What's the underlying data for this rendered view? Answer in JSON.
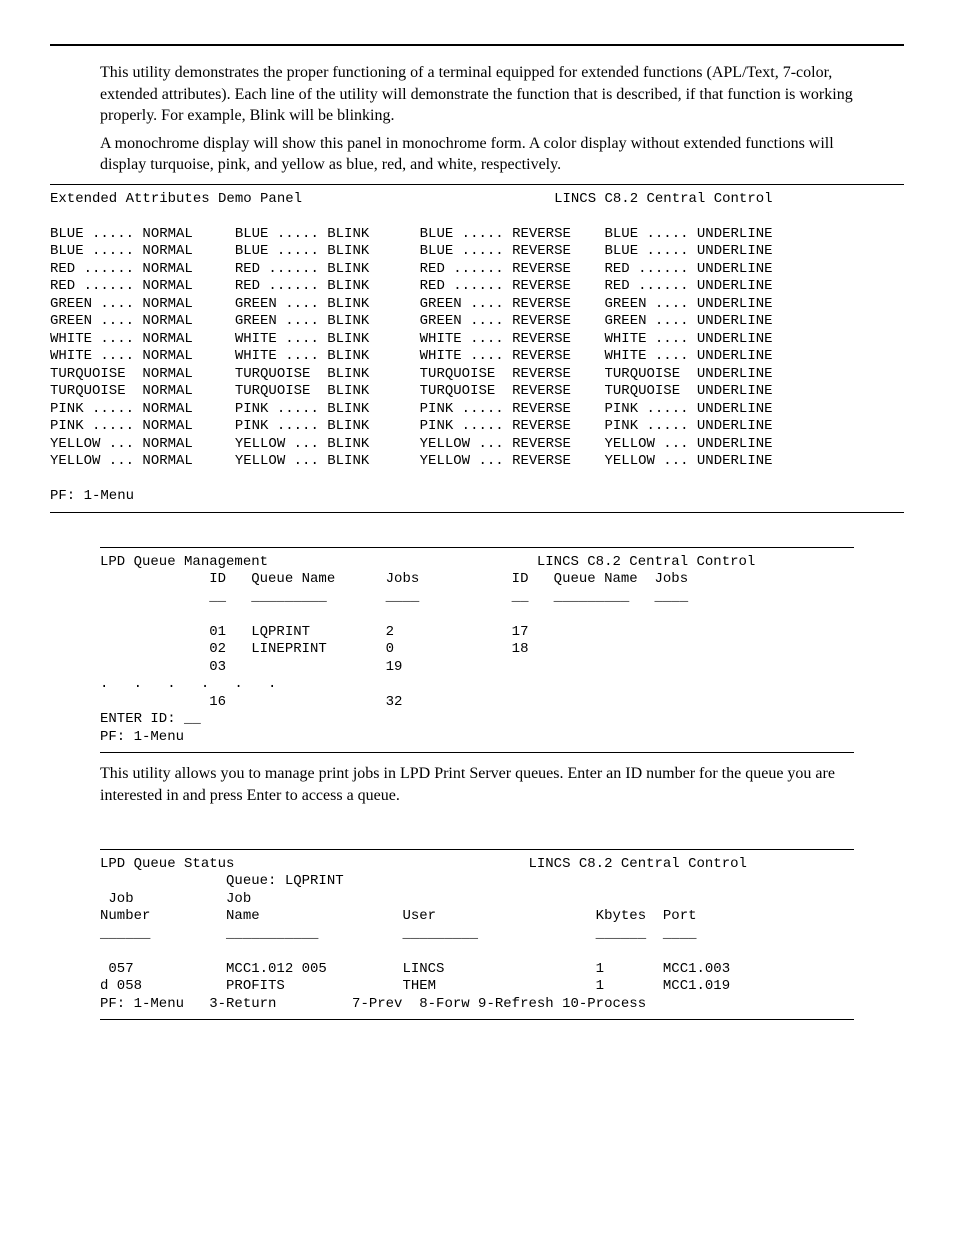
{
  "top": {
    "paragraphs": [
      "This utility demonstrates the proper functioning of a terminal equipped for extended functions (APL/Text, 7-color, extended attributes). Each line of the utility will demonstrate the function that is described, if that function is working properly. For example, Blink will be blinking.",
      "A monochrome display will show this panel in monochrome form. A color display without extended functions will display turquoise, pink, and yellow as blue, red, and white, respectively."
    ]
  },
  "panel1": {
    "title_left": "Extended Attributes Demo Panel",
    "title_right": "LINCS C8.2 Central Control",
    "colors": [
      "BLUE",
      "BLUE",
      "RED",
      "RED",
      "GREEN",
      "GREEN",
      "WHITE",
      "WHITE",
      "TURQUOISE",
      "TURQUOISE",
      "PINK",
      "PINK",
      "YELLOW",
      "YELLOW"
    ],
    "attrs": [
      "NORMAL",
      "BLINK",
      "REVERSE",
      "UNDERLINE"
    ],
    "footer": "PF: 1-Menu"
  },
  "panel2": {
    "title_left": "LPD Queue Management",
    "title_right": "LINCS C8.2 Central Control",
    "headers": {
      "id": "ID",
      "qn": "Queue Name",
      "jobs": "Jobs"
    },
    "rows_left": [
      {
        "id": "01",
        "name": "LQPRINT",
        "jobs": "2"
      },
      {
        "id": "02",
        "name": "LINEPRINT",
        "jobs": "0"
      },
      {
        "id": "03",
        "name": "",
        "jobs": "19"
      }
    ],
    "rows_right": [
      {
        "id": "17",
        "name": "",
        "jobs": ""
      },
      {
        "id": "18",
        "name": "",
        "jobs": ""
      }
    ],
    "continuation": ".   .   .   .   .   .",
    "last_left": {
      "id": "16",
      "name": "",
      "jobs": "32"
    },
    "enter_prompt": "ENTER ID: __",
    "footer": "PF: 1-Menu",
    "description": "This utility allows you to manage print jobs in LPD Print Server queues. Enter an ID number for the queue you are interested in and press Enter to access a queue."
  },
  "panel3": {
    "title_left": "LPD Queue Status",
    "title_right": "LINCS C8.2 Central Control",
    "queue_line": "Queue: LQPRINT",
    "headers": {
      "job_number1": "Job",
      "job_number2": "Number",
      "job_name1": "Job",
      "job_name2": "Name",
      "user": "User",
      "kbytes": "Kbytes",
      "port": "Port"
    },
    "rows": [
      {
        "num": " 057",
        "name": "MCC1.012 005",
        "user": "LINCS",
        "kb": "1",
        "port": "MCC1.003"
      },
      {
        "num": "d 058",
        "name": "PROFITS",
        "user": "THEM",
        "kb": "1",
        "port": "MCC1.019"
      }
    ],
    "footer": "PF: 1-Menu   3-Return         7-Prev  8-Forw 9-Refresh 10-Process"
  }
}
